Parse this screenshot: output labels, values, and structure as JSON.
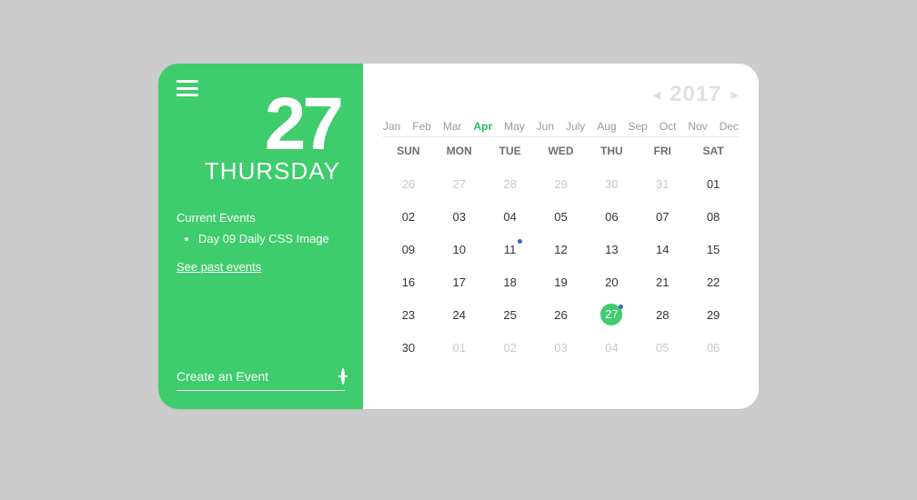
{
  "sidebar": {
    "day_number": "27",
    "weekday": "THURSDAY",
    "events_heading": "Current Events",
    "events": [
      "Day 09 Daily CSS Image"
    ],
    "see_past_label": "See past events",
    "create_placeholder": "Create an Event"
  },
  "calendar": {
    "year": "2017",
    "months": [
      "Jan",
      "Feb",
      "Mar",
      "Apr",
      "May",
      "Jun",
      "July",
      "Aug",
      "Sep",
      "Oct",
      "Nov",
      "Dec"
    ],
    "active_month_index": 3,
    "weekdays": [
      "SUN",
      "MON",
      "TUE",
      "WED",
      "THU",
      "FRI",
      "SAT"
    ],
    "days": [
      {
        "n": "26",
        "out": true
      },
      {
        "n": "27",
        "out": true
      },
      {
        "n": "28",
        "out": true
      },
      {
        "n": "29",
        "out": true
      },
      {
        "n": "30",
        "out": true
      },
      {
        "n": "31",
        "out": true
      },
      {
        "n": "01"
      },
      {
        "n": "02"
      },
      {
        "n": "03"
      },
      {
        "n": "04"
      },
      {
        "n": "05"
      },
      {
        "n": "06"
      },
      {
        "n": "07"
      },
      {
        "n": "08"
      },
      {
        "n": "09"
      },
      {
        "n": "10"
      },
      {
        "n": "11",
        "dot": true
      },
      {
        "n": "12"
      },
      {
        "n": "13"
      },
      {
        "n": "14"
      },
      {
        "n": "15"
      },
      {
        "n": "16"
      },
      {
        "n": "17"
      },
      {
        "n": "18"
      },
      {
        "n": "19"
      },
      {
        "n": "20"
      },
      {
        "n": "21"
      },
      {
        "n": "22"
      },
      {
        "n": "23"
      },
      {
        "n": "24"
      },
      {
        "n": "25"
      },
      {
        "n": "26"
      },
      {
        "n": "27",
        "selected": true,
        "dot": true
      },
      {
        "n": "28"
      },
      {
        "n": "29"
      },
      {
        "n": "30"
      },
      {
        "n": "01",
        "out": true
      },
      {
        "n": "02",
        "out": true
      },
      {
        "n": "03",
        "out": true
      },
      {
        "n": "04",
        "out": true
      },
      {
        "n": "05",
        "out": true
      },
      {
        "n": "06",
        "out": true
      }
    ]
  }
}
